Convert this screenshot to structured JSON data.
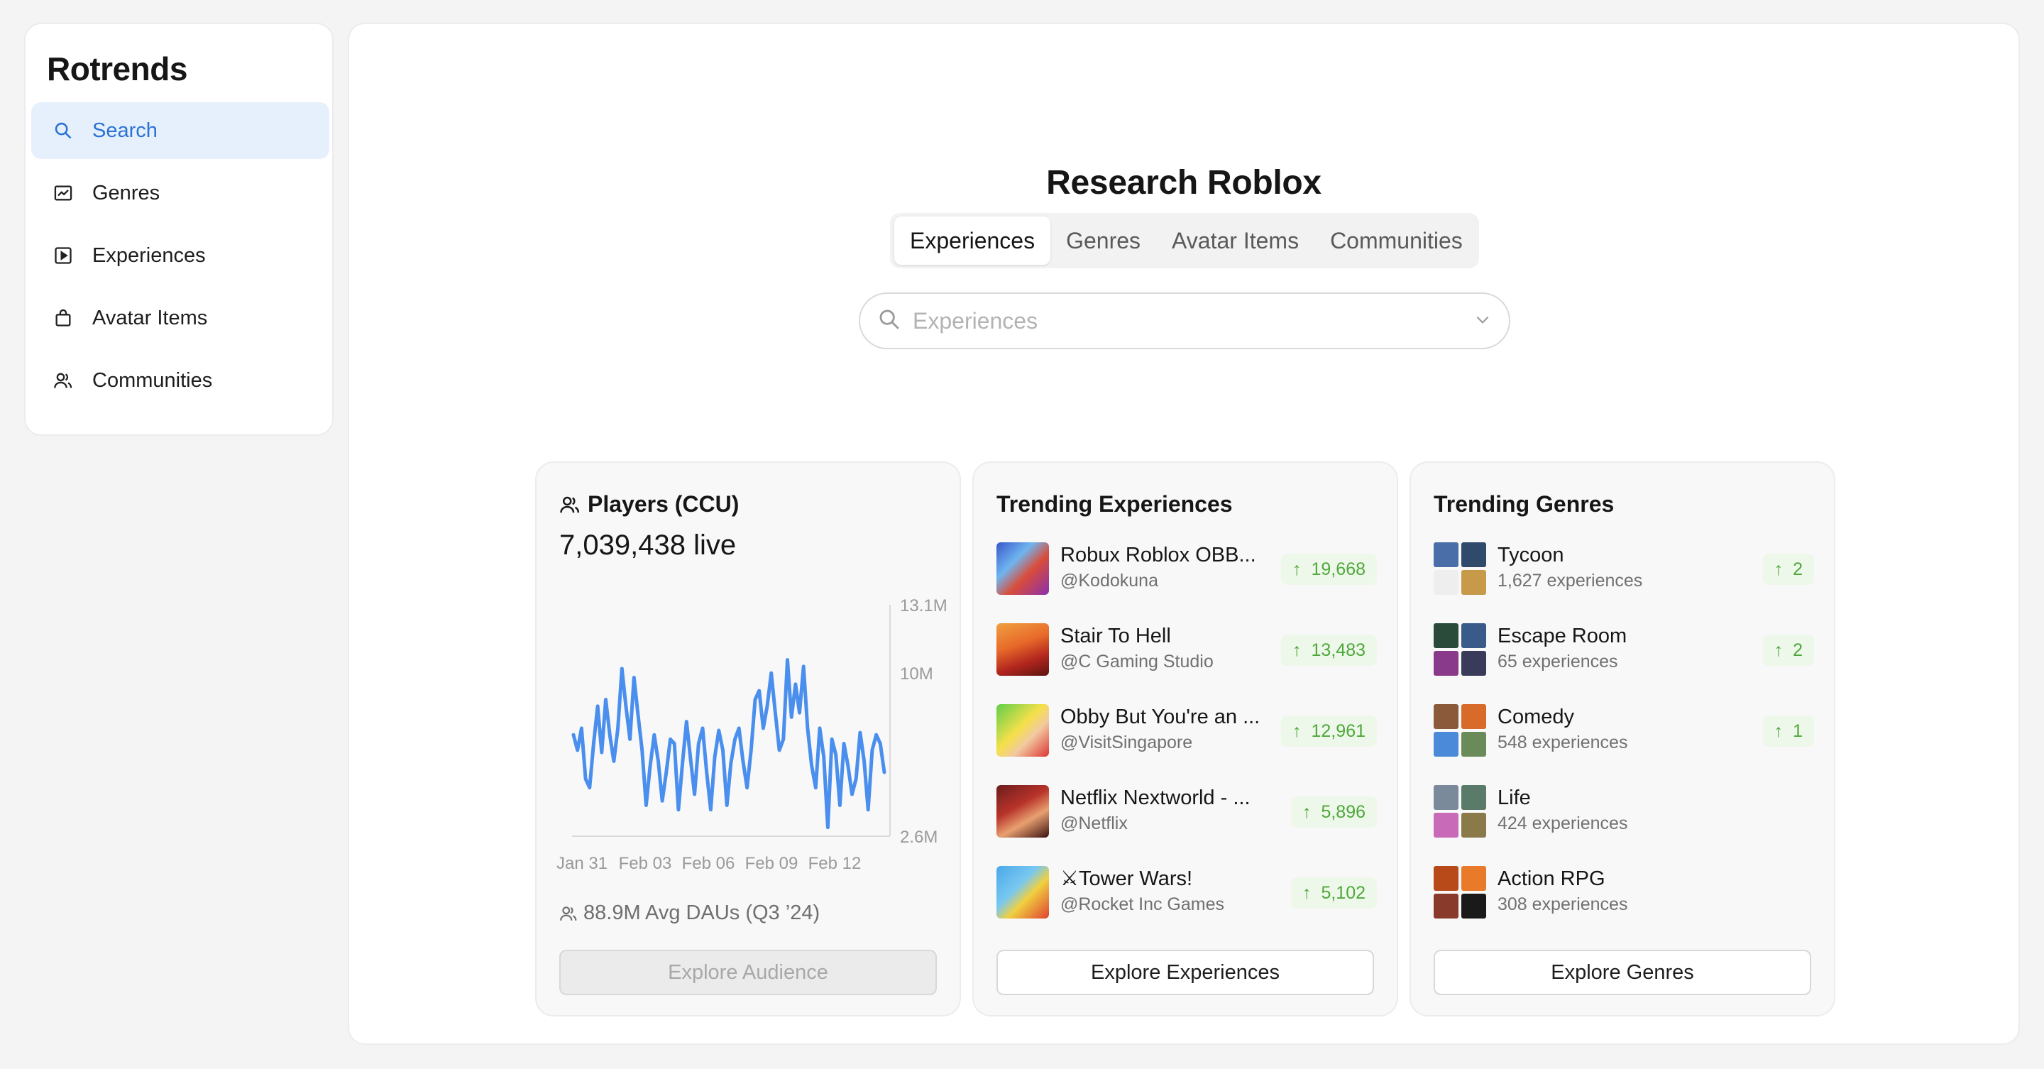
{
  "app": {
    "brand": "Rotrends"
  },
  "sidebar": {
    "items": [
      {
        "label": "Search",
        "icon": "search-icon",
        "active": true
      },
      {
        "label": "Genres",
        "icon": "chart-icon"
      },
      {
        "label": "Experiences",
        "icon": "play-square-icon"
      },
      {
        "label": "Avatar Items",
        "icon": "bag-icon"
      },
      {
        "label": "Communities",
        "icon": "users-icon"
      }
    ]
  },
  "main": {
    "title": "Research Roblox",
    "tabs": [
      "Experiences",
      "Genres",
      "Avatar Items",
      "Communities"
    ],
    "active_tab": "Experiences",
    "search": {
      "placeholder": "Experiences"
    }
  },
  "players": {
    "title": "Players (CCU)",
    "live": "7,039,438 live",
    "dau": "88.9M Avg DAUs (Q3 ’24)",
    "button": "Explore Audience"
  },
  "chart_data": {
    "type": "line",
    "title": "",
    "x_ticks": [
      "Jan 31",
      "Feb 03",
      "Feb 06",
      "Feb 09",
      "Feb 12"
    ],
    "y_ticks": [
      "13.1M",
      "10M",
      "2.6M"
    ],
    "ylim": [
      2.6,
      13.1
    ],
    "grid": false,
    "series": [
      {
        "values": [
          7.2,
          6.5,
          7.5,
          5.2,
          4.8,
          6.8,
          8.5,
          6.4,
          8.8,
          7.2,
          6.0,
          7.5,
          10.2,
          8.5,
          7.0,
          9.8,
          8.1,
          6.5,
          4.0,
          5.8,
          7.2,
          6.0,
          4.2,
          5.5,
          7.0,
          6.8,
          3.8,
          5.9,
          7.8,
          6.1,
          4.5,
          6.8,
          7.5,
          5.5,
          3.8,
          6.2,
          7.4,
          6.5,
          4.0,
          5.9,
          7.0,
          7.5,
          6.0,
          4.8,
          6.5,
          8.8,
          9.2,
          7.5,
          8.5,
          10.0,
          8.2,
          6.5,
          7.0,
          10.6,
          8.0,
          9.5,
          8.2,
          10.3,
          7.5,
          5.8,
          4.8,
          7.5,
          6.2,
          3.0,
          7.0,
          6.3,
          4.0,
          6.8,
          5.8,
          4.5,
          5.2,
          7.3,
          6.0,
          3.8,
          6.5,
          7.2,
          6.8,
          5.5
        ]
      }
    ],
    "color": "#4a8fee"
  },
  "trending_experiences": {
    "title": "Trending Experiences",
    "items": [
      {
        "name": "Robux Roblox OBB...",
        "creator": "@Kodokuna",
        "delta": "19,668"
      },
      {
        "name": "Stair To Hell",
        "creator": "@C Gaming Studio",
        "delta": "13,483"
      },
      {
        "name": "Obby But You're an ...",
        "creator": "@VisitSingapore",
        "delta": "12,961"
      },
      {
        "name": "Netflix Nextworld - ...",
        "creator": "@Netflix",
        "delta": "5,896"
      },
      {
        "name": "⚔Tower Wars!",
        "creator": "@Rocket Inc Games",
        "delta": "5,102"
      }
    ],
    "button": "Explore Experiences"
  },
  "trending_genres": {
    "title": "Trending Genres",
    "items": [
      {
        "name": "Tycoon",
        "count": "1,627 experiences",
        "delta": "2"
      },
      {
        "name": "Escape Room",
        "count": "65 experiences",
        "delta": "2"
      },
      {
        "name": "Comedy",
        "count": "548 experiences",
        "delta": "1"
      },
      {
        "name": "Life",
        "count": "424 experiences",
        "delta": ""
      },
      {
        "name": "Action RPG",
        "count": "308 experiences",
        "delta": ""
      }
    ],
    "button": "Explore Genres"
  },
  "colors": {
    "accent": "#2b72d6",
    "accent_bg": "#e6f0fc",
    "up_green": "#4ea83a",
    "up_bg": "#eef8ea"
  }
}
